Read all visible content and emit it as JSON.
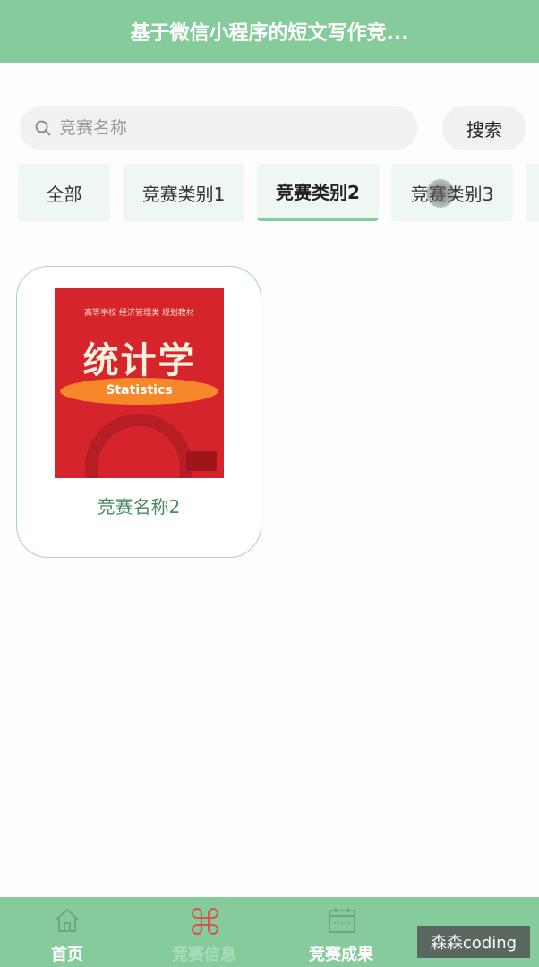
{
  "header": {
    "title": "基于微信小程序的短文写作竞..."
  },
  "search": {
    "placeholder": "竞赛名称",
    "button_label": "搜索"
  },
  "categories": [
    {
      "label": "全部",
      "active": false
    },
    {
      "label": "竞赛类别1",
      "active": false
    },
    {
      "label": "竞赛类别2",
      "active": true
    },
    {
      "label": "竞赛类别3",
      "active": false
    }
  ],
  "items": [
    {
      "name": "竞赛名称2",
      "cover": {
        "series": "高等学校 经济管理类 规划教材",
        "title": "统计学",
        "subtitle": "Statistics"
      }
    }
  ],
  "tabbar": [
    {
      "label": "首页",
      "icon": "home-icon",
      "active": true
    },
    {
      "label": "竞赛信息",
      "icon": "grid-icon",
      "active": false
    },
    {
      "label": "竞赛成果",
      "icon": "calendar-icon",
      "active": true
    }
  ],
  "watermark": "森森coding",
  "colors": {
    "primary": "#85cb9b",
    "icon_accent": "#d9534f",
    "muted_label": "#a9dcb8"
  }
}
